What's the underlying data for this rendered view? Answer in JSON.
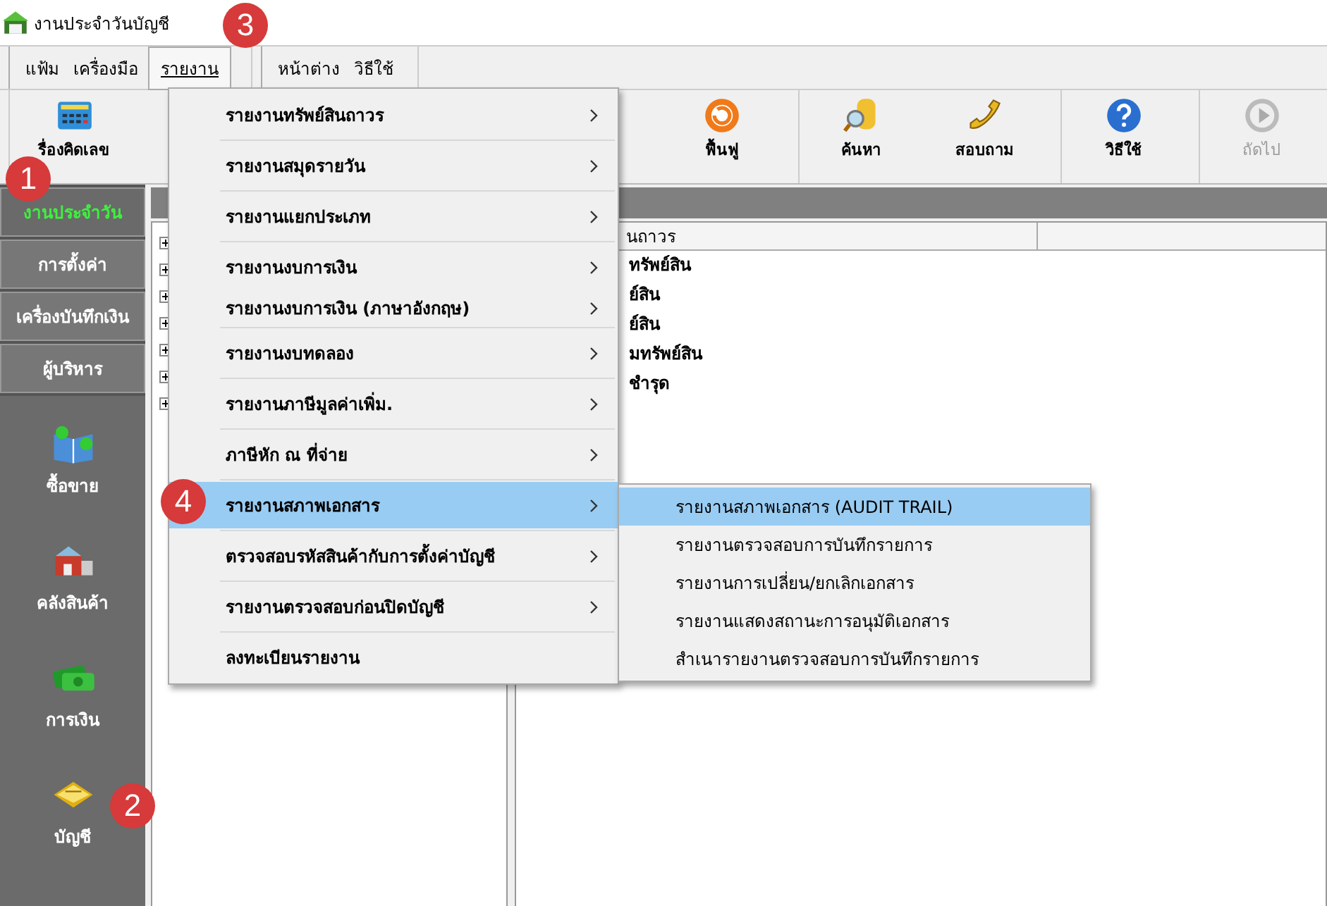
{
  "window": {
    "title": "งานประจำวันบัญชี"
  },
  "menu_bar": [
    {
      "label": "แฟ้ม",
      "selected": false
    },
    {
      "label": "เครื่องมือ",
      "selected": false
    },
    {
      "label": "รายงาน",
      "selected": true
    },
    {
      "label": "หน้าต่าง",
      "selected": false
    },
    {
      "label": "วิธีใช้",
      "selected": false
    }
  ],
  "toolbar": [
    {
      "label": "รื่องคิดเลข",
      "kind": "calculator",
      "disabled": false
    },
    {
      "label": "ฟื้นฟู",
      "kind": "refresh",
      "disabled": false
    },
    {
      "label": "ค้นหา",
      "kind": "search",
      "disabled": false
    },
    {
      "label": "สอบถาม",
      "kind": "phone",
      "disabled": false
    },
    {
      "label": "วิธีใช้",
      "kind": "help",
      "disabled": false
    },
    {
      "label": "ถัดไป",
      "kind": "next",
      "disabled": true
    }
  ],
  "sidebar": {
    "tabs": [
      {
        "label": "งานประจำวัน",
        "selected": true
      },
      {
        "label": "การตั้งค่า",
        "selected": false
      },
      {
        "label": "เครื่องบันทึกเงิน",
        "selected": false
      },
      {
        "label": "ผู้บริหาร",
        "selected": false
      }
    ],
    "modules": [
      {
        "label": "ซื้อขาย",
        "kind": "trade"
      },
      {
        "label": "คลังสินค้า",
        "kind": "warehouse"
      },
      {
        "label": "การเงิน",
        "kind": "money"
      },
      {
        "label": "บัญชี",
        "kind": "ledger"
      }
    ]
  },
  "tree": {
    "nodes": [
      {
        "expanded": false
      },
      {
        "expanded": false
      },
      {
        "expanded": false
      },
      {
        "expanded": false
      },
      {
        "expanded": false
      },
      {
        "expanded": false
      },
      {
        "expanded": false
      }
    ]
  },
  "list": {
    "column_1": "นถาวร",
    "rows": [
      "ทรัพย์สิน",
      "ย์สิน",
      "ย์สิน",
      "มทรัพย์สิน",
      "ชำรุด"
    ]
  },
  "report_menu": {
    "groups": [
      [
        {
          "label": "รายงานทรัพย์สินถาวร",
          "submenu": true,
          "selected": false
        }
      ],
      [
        {
          "label": "รายงานสมุดรายวัน",
          "submenu": true,
          "selected": false
        }
      ],
      [
        {
          "label": "รายงานแยกประเภท",
          "submenu": true,
          "selected": false
        }
      ],
      [
        {
          "label": "รายงานงบการเงิน",
          "submenu": true,
          "selected": false
        },
        {
          "label": "รายงานงบการเงิน (ภาษาอังกฤษ)",
          "submenu": true,
          "selected": false
        }
      ],
      [
        {
          "label": "รายงานงบทดลอง",
          "submenu": true,
          "selected": false
        }
      ],
      [
        {
          "label": "รายงานภาษีมูลค่าเพิ่ม.",
          "submenu": true,
          "selected": false
        }
      ],
      [
        {
          "label": "ภาษีหัก ณ ที่จ่าย",
          "submenu": true,
          "selected": false
        }
      ],
      [
        {
          "label": "รายงานสภาพเอกสาร",
          "submenu": true,
          "selected": true
        }
      ],
      [
        {
          "label": "ตรวจสอบรหัสสินค้ากับการตั้งค่าบัญชี",
          "submenu": true,
          "selected": false
        }
      ],
      [
        {
          "label": "รายงานตรวจสอบก่อนปิดบัญชี",
          "submenu": true,
          "selected": false
        }
      ],
      [
        {
          "label": "ลงทะเบียนรายงาน",
          "submenu": false,
          "selected": false
        }
      ]
    ]
  },
  "submenu": [
    {
      "label": "รายงานสภาพเอกสาร (AUDIT TRAIL)",
      "selected": true
    },
    {
      "label": "รายงานตรวจสอบการบันทึกรายการ",
      "selected": false
    },
    {
      "label": "รายงานการเปลี่ยน/ยกเลิกเอกสาร",
      "selected": false
    },
    {
      "label": "รายงานแสดงสถานะการอนุมัติเอกสาร",
      "selected": false
    },
    {
      "label": "สำเนารายงานตรวจสอบการบันทึกรายการ",
      "selected": false
    }
  ],
  "callouts": [
    "1",
    "2",
    "3",
    "4"
  ]
}
